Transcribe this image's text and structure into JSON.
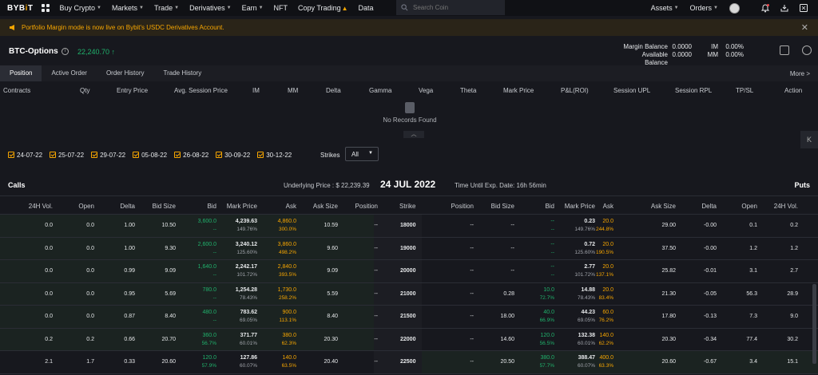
{
  "nav": {
    "logo_a": "BYB",
    "logo_b": "i",
    "logo_c": "T",
    "items": [
      "Buy Crypto",
      "Markets",
      "Trade",
      "Derivatives",
      "Earn",
      "NFT",
      "Copy Trading",
      "Data"
    ],
    "search_placeholder": "Search Coin",
    "assets": "Assets",
    "orders": "Orders"
  },
  "banner": {
    "text": "Portfolio Margin mode is now live on Bybit's USDC Derivatives Account."
  },
  "header": {
    "title": "BTC-Options",
    "price": "22,240.70",
    "margin_balance_label": "Margin Balance",
    "margin_balance_value": "0.0000",
    "available_balance_label": "Available Balance",
    "available_balance_value": "0.0000",
    "im_label": "IM",
    "im_value": "0.00%",
    "mm_label": "MM",
    "mm_value": "0.00%"
  },
  "tabs": [
    "Position",
    "Active Order",
    "Order History",
    "Trade History"
  ],
  "more_label": "More",
  "positions_columns": [
    "Contracts",
    "Qty",
    "Entry Price",
    "Avg. Session Price",
    "IM",
    "MM",
    "Delta",
    "Gamma",
    "Vega",
    "Theta",
    "Mark Price",
    "P&L(ROI)",
    "Session UPL",
    "Session RPL",
    "TP/SL",
    "Action"
  ],
  "no_records": "No Records Found",
  "expiry_dates": [
    "24-07-22",
    "25-07-22",
    "29-07-22",
    "05-08-22",
    "26-08-22",
    "30-09-22",
    "30-12-22"
  ],
  "strikes": {
    "label": "Strikes",
    "value": "All"
  },
  "chain_header": {
    "calls": "Calls",
    "puts": "Puts",
    "underlying": "Underlying Price : $ 22,239.39",
    "expiry": "24 JUL 2022",
    "time_until": "Time Until Exp. Date:   16h 56min"
  },
  "chain_columns": {
    "calls": [
      "24H Vol.",
      "Open",
      "Delta",
      "Bid Size",
      "Bid",
      "Mark Price",
      "Ask",
      "Ask Size",
      "Position"
    ],
    "strike": "Strike",
    "puts": [
      "Position",
      "Bid Size",
      "Bid",
      "Mark Price",
      "Ask",
      "Ask Size",
      "Delta",
      "Open",
      "24H Vol."
    ]
  },
  "chain_rows": [
    {
      "strike": "18000",
      "c_vol": "0.0",
      "c_open": "0.0",
      "c_delta": "1.00",
      "c_bidsize": "10.50",
      "c_bid": "3,600.0",
      "c_bid2": "--",
      "c_mark": "4,239.63",
      "c_mark2": "149.76%",
      "c_ask": "4,860.0",
      "c_ask2": "300.0%",
      "c_asksize": "10.59",
      "c_pos": "--",
      "p_pos": "--",
      "p_bidsize": "--",
      "p_bid": "--",
      "p_bid2": "--",
      "p_mark": "0.23",
      "p_mark2": "149.76%",
      "p_ask": "20.0",
      "p_ask2": "244.8%",
      "p_asksize": "29.00",
      "p_delta": "-0.00",
      "p_open": "0.1",
      "p_vol": "0.2"
    },
    {
      "strike": "19000",
      "c_vol": "0.0",
      "c_open": "0.0",
      "c_delta": "1.00",
      "c_bidsize": "9.30",
      "c_bid": "2,600.0",
      "c_bid2": "--",
      "c_mark": "3,240.12",
      "c_mark2": "125.60%",
      "c_ask": "3,860.0",
      "c_ask2": "498.2%",
      "c_asksize": "9.60",
      "c_pos": "--",
      "p_pos": "--",
      "p_bidsize": "--",
      "p_bid": "--",
      "p_bid2": "--",
      "p_mark": "0.72",
      "p_mark2": "125.60%",
      "p_ask": "20.0",
      "p_ask2": "190.5%",
      "p_asksize": "37.50",
      "p_delta": "-0.00",
      "p_open": "1.2",
      "p_vol": "1.2"
    },
    {
      "strike": "20000",
      "c_vol": "0.0",
      "c_open": "0.0",
      "c_delta": "0.99",
      "c_bidsize": "9.09",
      "c_bid": "1,640.0",
      "c_bid2": "--",
      "c_mark": "2,242.17",
      "c_mark2": "101.72%",
      "c_ask": "2,840.0",
      "c_ask2": "393.5%",
      "c_asksize": "9.09",
      "c_pos": "--",
      "p_pos": "--",
      "p_bidsize": "--",
      "p_bid": "--",
      "p_bid2": "--",
      "p_mark": "2.77",
      "p_mark2": "101.72%",
      "p_ask": "20.0",
      "p_ask2": "137.1%",
      "p_asksize": "25.82",
      "p_delta": "-0.01",
      "p_open": "3.1",
      "p_vol": "2.7"
    },
    {
      "strike": "21000",
      "c_vol": "0.0",
      "c_open": "0.0",
      "c_delta": "0.95",
      "c_bidsize": "5.69",
      "c_bid": "780.0",
      "c_bid2": "--",
      "c_mark": "1,254.28",
      "c_mark2": "78.43%",
      "c_ask": "1,730.0",
      "c_ask2": "258.2%",
      "c_asksize": "5.59",
      "c_pos": "--",
      "p_pos": "--",
      "p_bidsize": "0.28",
      "p_bid": "10.0",
      "p_bid2": "72.7%",
      "p_mark": "14.88",
      "p_mark2": "78.43%",
      "p_ask": "20.0",
      "p_ask2": "83.4%",
      "p_asksize": "21.30",
      "p_delta": "-0.05",
      "p_open": "56.3",
      "p_vol": "28.9"
    },
    {
      "strike": "21500",
      "c_vol": "0.0",
      "c_open": "0.0",
      "c_delta": "0.87",
      "c_bidsize": "8.40",
      "c_bid": "480.0",
      "c_bid2": "--",
      "c_mark": "783.62",
      "c_mark2": "69.05%",
      "c_ask": "900.0",
      "c_ask2": "113.1%",
      "c_asksize": "8.40",
      "c_pos": "--",
      "p_pos": "--",
      "p_bidsize": "18.00",
      "p_bid": "40.0",
      "p_bid2": "66.9%",
      "p_mark": "44.23",
      "p_mark2": "69.05%",
      "p_ask": "60.0",
      "p_ask2": "76.2%",
      "p_asksize": "17.80",
      "p_delta": "-0.13",
      "p_open": "7.3",
      "p_vol": "9.0"
    },
    {
      "strike": "22000",
      "c_vol": "0.2",
      "c_open": "0.2",
      "c_delta": "0.66",
      "c_bidsize": "20.70",
      "c_bid": "360.0",
      "c_bid2": "56.7%",
      "c_mark": "371.77",
      "c_mark2": "60.01%",
      "c_ask": "380.0",
      "c_ask2": "62.3%",
      "c_asksize": "20.30",
      "c_pos": "--",
      "p_pos": "--",
      "p_bidsize": "14.60",
      "p_bid": "120.0",
      "p_bid2": "56.5%",
      "p_mark": "132.38",
      "p_mark2": "60.01%",
      "p_ask": "140.0",
      "p_ask2": "62.2%",
      "p_asksize": "20.30",
      "p_delta": "-0.34",
      "p_open": "77.4",
      "p_vol": "30.2"
    },
    {
      "strike": "22500",
      "c_vol": "2.1",
      "c_open": "1.7",
      "c_delta": "0.33",
      "c_bidsize": "20.60",
      "c_bid": "120.0",
      "c_bid2": "57.9%",
      "c_mark": "127.86",
      "c_mark2": "60.07%",
      "c_ask": "140.0",
      "c_ask2": "63.5%",
      "c_asksize": "20.40",
      "c_pos": "--",
      "p_pos": "--",
      "p_bidsize": "20.50",
      "p_bid": "380.0",
      "p_bid2": "57.7%",
      "p_mark": "388.47",
      "p_mark2": "60.07%",
      "p_ask": "400.0",
      "p_ask2": "63.3%",
      "p_asksize": "20.60",
      "p_delta": "-0.67",
      "p_open": "3.4",
      "p_vol": "15.1"
    }
  ],
  "colors": {
    "accent": "#f7a600",
    "green": "#20b26c",
    "bg": "#17181e"
  }
}
